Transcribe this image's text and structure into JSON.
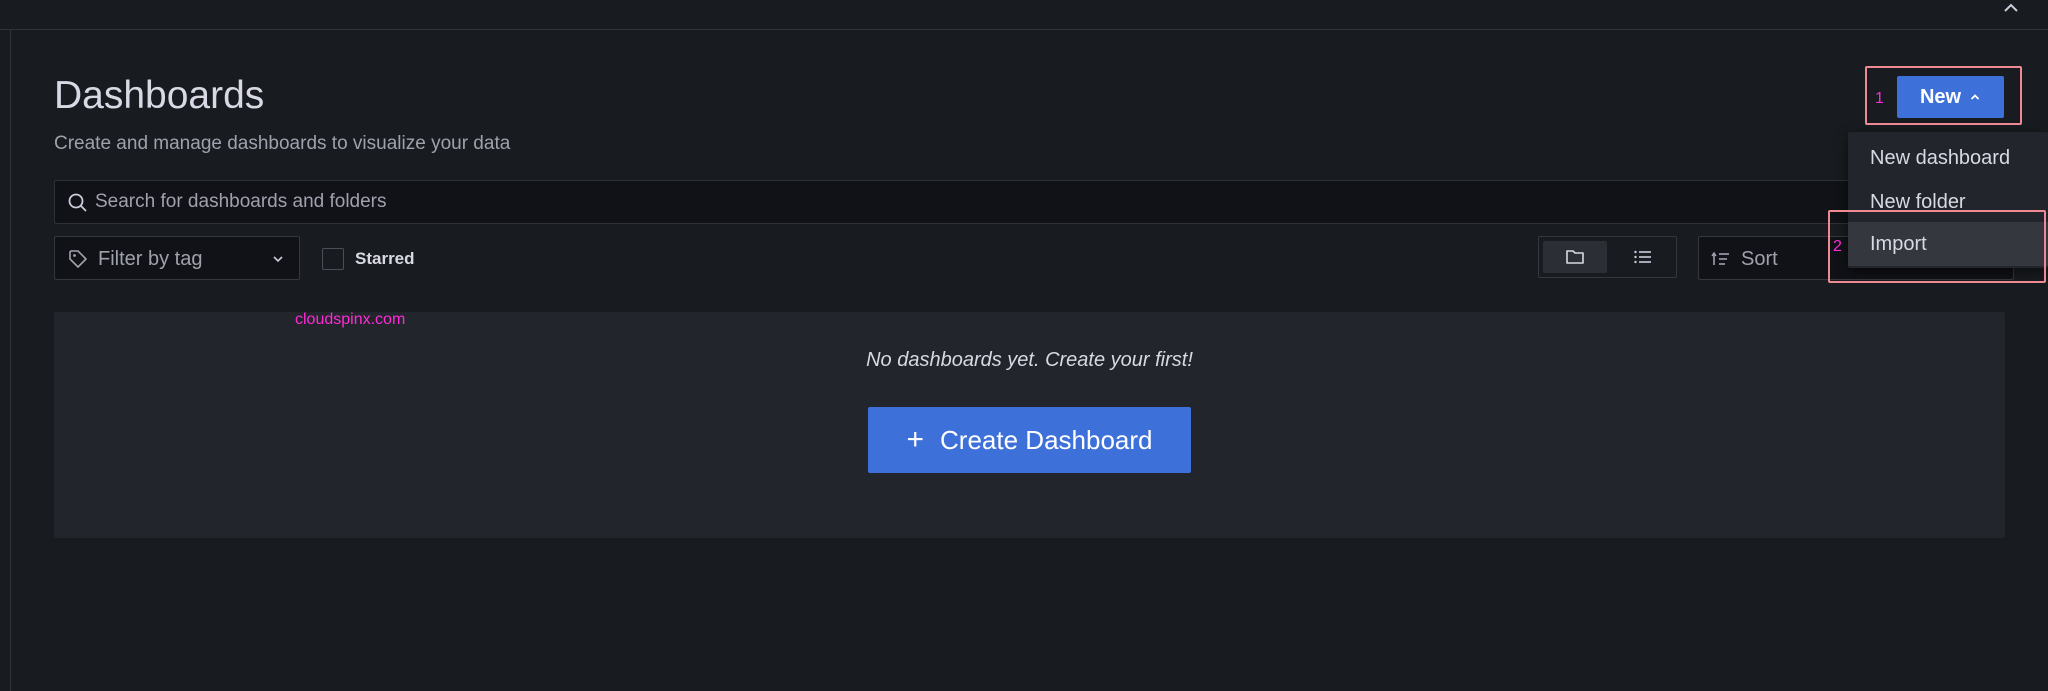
{
  "header": {
    "title": "Dashboards",
    "subtitle": "Create and manage dashboards to visualize your data"
  },
  "search": {
    "placeholder": "Search for dashboards and folders",
    "value": ""
  },
  "filters": {
    "tag_label": "Filter by tag",
    "starred_label": "Starred",
    "starred_checked": false,
    "sort_label": "Sort",
    "view_mode": "folder"
  },
  "empty_state": {
    "message": "No dashboards yet. Create your first!",
    "button_label": "Create Dashboard"
  },
  "new_menu": {
    "button_label": "New",
    "items": [
      {
        "label": "New dashboard"
      },
      {
        "label": "New folder"
      },
      {
        "label": "Import"
      }
    ],
    "highlighted": "Import"
  },
  "annotations": {
    "step1": "1",
    "step2": "2",
    "watermark": "cloudspinx.com"
  },
  "colors": {
    "accent": "#3d71d9",
    "background": "#181b1f",
    "panel": "#22252b",
    "annotation": "#f08a92",
    "watermark": "#ff2bd6"
  }
}
